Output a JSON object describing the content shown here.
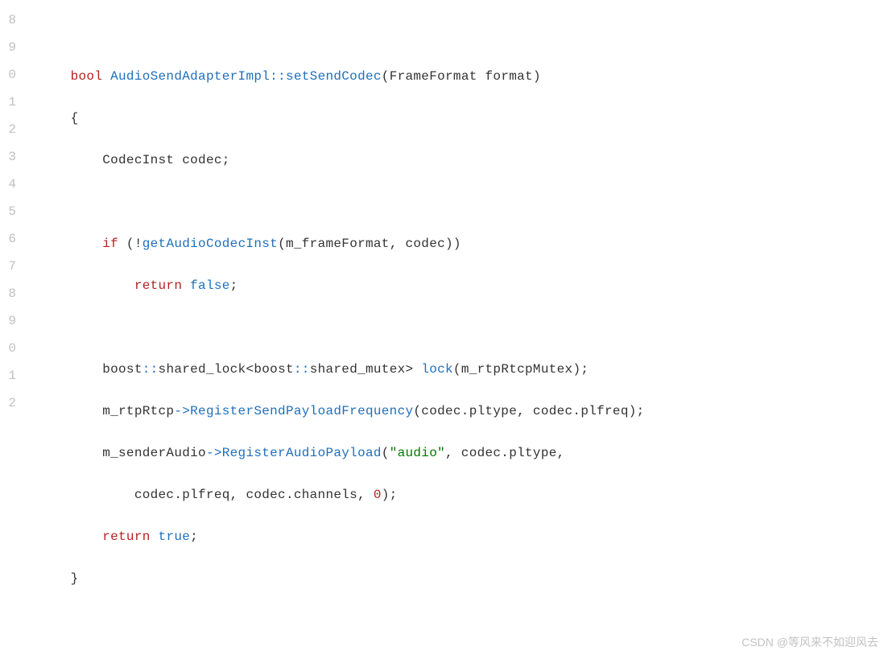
{
  "gutter": [
    "8",
    "9",
    "0",
    "1",
    "2",
    "3",
    "4",
    "5",
    "6",
    "7",
    "8",
    "9",
    "0",
    "1",
    "2"
  ],
  "code": {
    "l0": "",
    "l1_kw": "bool",
    "l1_cls": "AudioSendAdapterImpl",
    "l1_sep": "::",
    "l1_fn": "setSendCodec",
    "l1_paren_open": "(",
    "l1_ptype": "FrameFormat",
    "l1_pname": " format",
    "l1_paren_close": ")",
    "l2": "    {",
    "l3_a": "        ",
    "l3_type": "CodecInst",
    "l3_b": " codec;",
    "l4": "",
    "l5_a": "        ",
    "l5_if": "if",
    "l5_b": " (!",
    "l5_fn": "getAudioCodecInst",
    "l5_c": "(m_frameFormat, codec))",
    "l6_a": "            ",
    "l6_ret": "return",
    "l6_sp": " ",
    "l6_val": "false",
    "l6_semi": ";",
    "l7": "",
    "l8_a": "        boost",
    "l8_op1": "::",
    "l8_b": "shared_lock<boost",
    "l8_op2": "::",
    "l8_c": "shared_mutex> ",
    "l8_fn": "lock",
    "l8_d": "(m_rtpRtcpMutex);",
    "l9_a": "        m_rtpRtcp",
    "l9_arr": "->",
    "l9_fn": "RegisterSendPayloadFrequency",
    "l9_b": "(codec.pltype, codec.plfreq);",
    "l10_a": "        m_senderAudio",
    "l10_arr": "->",
    "l10_fn": "RegisterAudioPayload",
    "l10_b": "(",
    "l10_str": "\"audio\"",
    "l10_c": ", codec.pltype,",
    "l11_a": "            codec.plfreq, codec.channels, ",
    "l11_num": "0",
    "l11_b": ");",
    "l12_a": "        ",
    "l12_ret": "return",
    "l12_sp": " ",
    "l12_val": "true",
    "l12_semi": ";",
    "l13": "    }",
    "l14": ""
  },
  "watermark": "CSDN @等风来不如迎风去"
}
